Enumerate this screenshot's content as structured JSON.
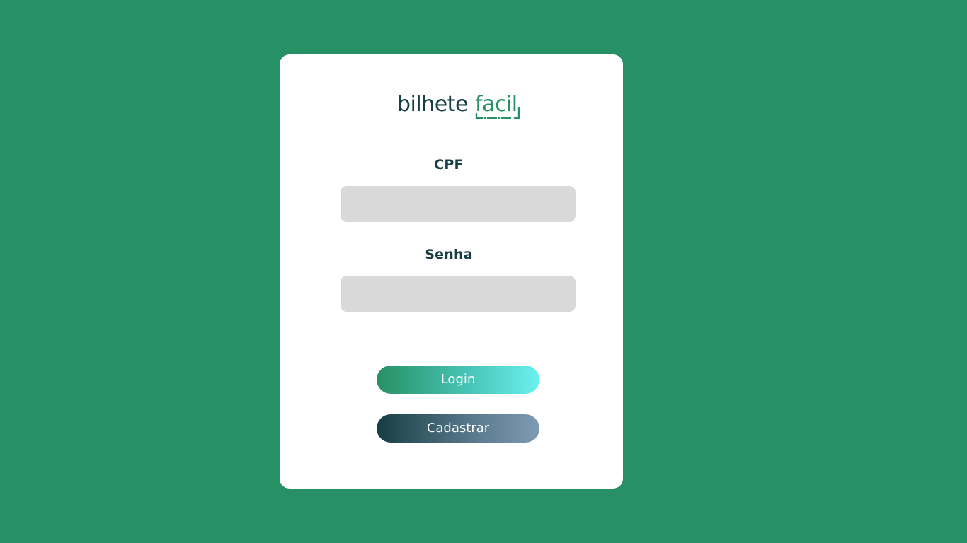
{
  "brand": {
    "logo_text_part1": "bilhete",
    "logo_text_part2": "facil",
    "colors": {
      "dark": "#173e43",
      "green": "#279065"
    }
  },
  "form": {
    "cpf_label": "CPF",
    "cpf_value": "",
    "cpf_placeholder": "",
    "senha_label": "Senha",
    "senha_value": "",
    "senha_placeholder": ""
  },
  "buttons": {
    "login_label": "Login",
    "cadastrar_label": "Cadastrar"
  },
  "colors": {
    "background": "#279065",
    "card": "#ffffff",
    "input": "#d9d9d9",
    "label": "#173e43"
  }
}
